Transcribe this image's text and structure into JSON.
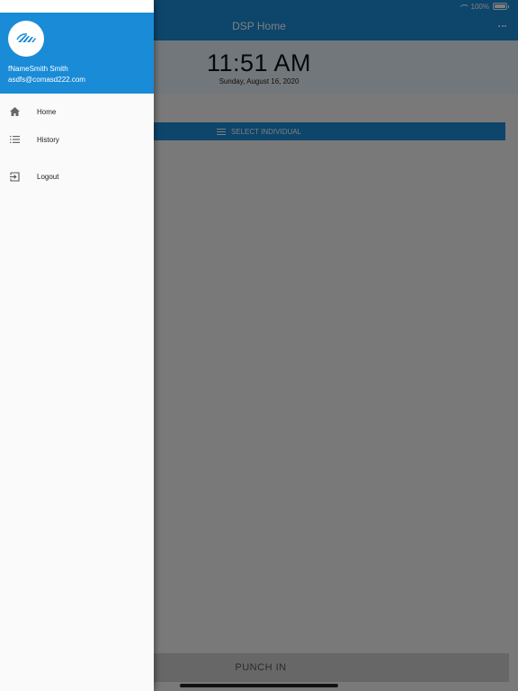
{
  "status_bar": {
    "battery": "100%"
  },
  "header": {
    "title": "DSP Home"
  },
  "clock": {
    "time": "11:51 AM",
    "date": "Sunday, August 16, 2020"
  },
  "actions": {
    "select_label": "SELECT INDIVIDUAL",
    "punch_label": "PUNCH IN"
  },
  "drawer": {
    "user_name": "fNameSmith Smith",
    "user_email": "asdfs@comasd222.com",
    "items": [
      {
        "label": "Home",
        "icon": "home-icon"
      },
      {
        "label": "History",
        "icon": "list-icon"
      },
      {
        "label": "Logout",
        "icon": "logout-icon"
      }
    ]
  },
  "colors": {
    "primary": "#1a8bd6",
    "scrim": "rgba(0,0,0,0.5)",
    "drawer_bg": "#fafafa"
  }
}
